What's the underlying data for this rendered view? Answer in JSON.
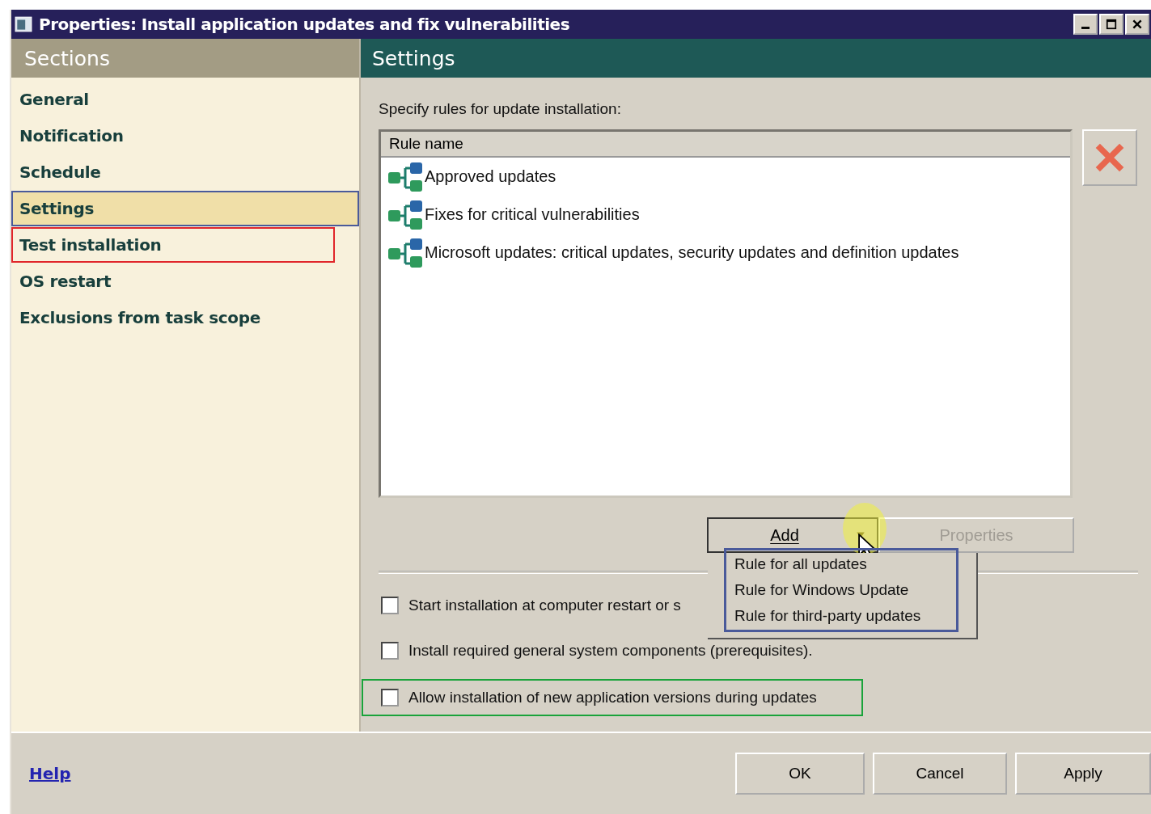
{
  "window": {
    "title": "Properties: Install application updates and fix vulnerabilities"
  },
  "sections": {
    "title": "Sections",
    "items": [
      {
        "label": "General",
        "selected": false
      },
      {
        "label": "Notification",
        "selected": false
      },
      {
        "label": "Schedule",
        "selected": false
      },
      {
        "label": "Settings",
        "selected": true,
        "color": "#4a5a9a"
      },
      {
        "label": "Test installation",
        "selected": false,
        "color": "#e0262a"
      },
      {
        "label": "OS restart",
        "selected": false
      },
      {
        "label": "Exclusions from task scope",
        "selected": false
      }
    ]
  },
  "settings": {
    "title": "Settings",
    "prompt": "Specify rules for update installation:",
    "rules": {
      "column": "Rule name",
      "rows": [
        "Approved updates",
        "Fixes for critical vulnerabilities",
        "Microsoft updates: critical updates, security updates and definition updates"
      ]
    },
    "add_button": "Add",
    "properties_button": {
      "label": "Properties",
      "disabled": true
    },
    "add_menu": {
      "color": "#4a5a9a",
      "items": [
        "Rule for all updates",
        "Rule for Windows Update",
        "Rule for third-party updates"
      ]
    },
    "options": [
      {
        "label": "Start installation at computer restart or s",
        "checked": false
      },
      {
        "label": "Install required general system components (prerequisites).",
        "checked": false
      },
      {
        "label": "Allow installation of new application versions during updates",
        "checked": false,
        "color": "#1aa33a"
      }
    ]
  },
  "footer": {
    "help": "Help",
    "buttons": [
      "OK",
      "Cancel",
      "Apply"
    ]
  }
}
